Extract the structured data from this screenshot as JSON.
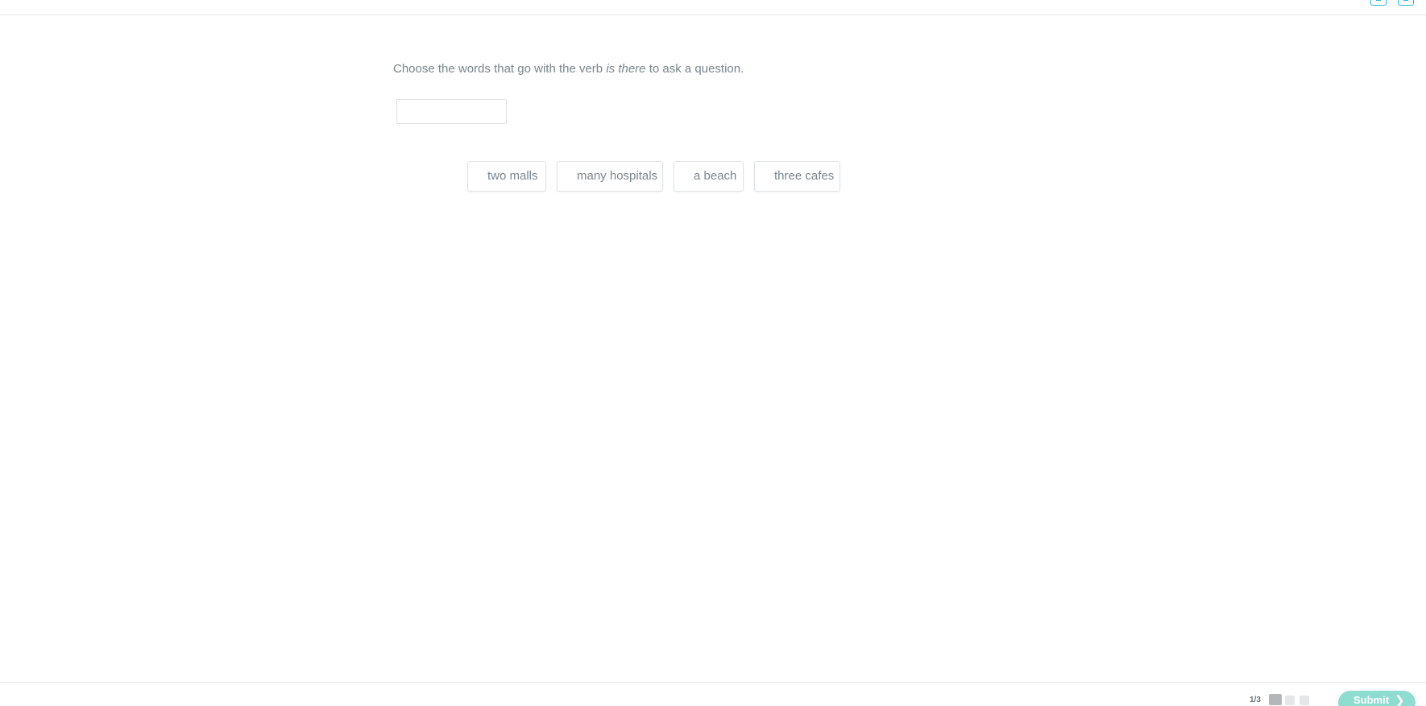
{
  "header": {
    "title": "",
    "icon_1": "list-icon",
    "icon_2": "flag-icon",
    "accent_color": "#29b6d8"
  },
  "question": {
    "prompt_before": "Choose the words that go with the verb ",
    "prompt_em": "is there",
    "prompt_after": " to ask a question."
  },
  "answer_slot": {
    "value": ""
  },
  "word_bank": [
    {
      "label": "two malls"
    },
    {
      "label": "many hospitals"
    },
    {
      "label": "a beach"
    },
    {
      "label": "three cafes"
    }
  ],
  "footer": {
    "progress": "1/3",
    "current_step": 1,
    "total_steps": 3,
    "submit_label": "Submit",
    "submit_icon": "chevron-right-icon",
    "submit_color": "#8fdcd0"
  }
}
